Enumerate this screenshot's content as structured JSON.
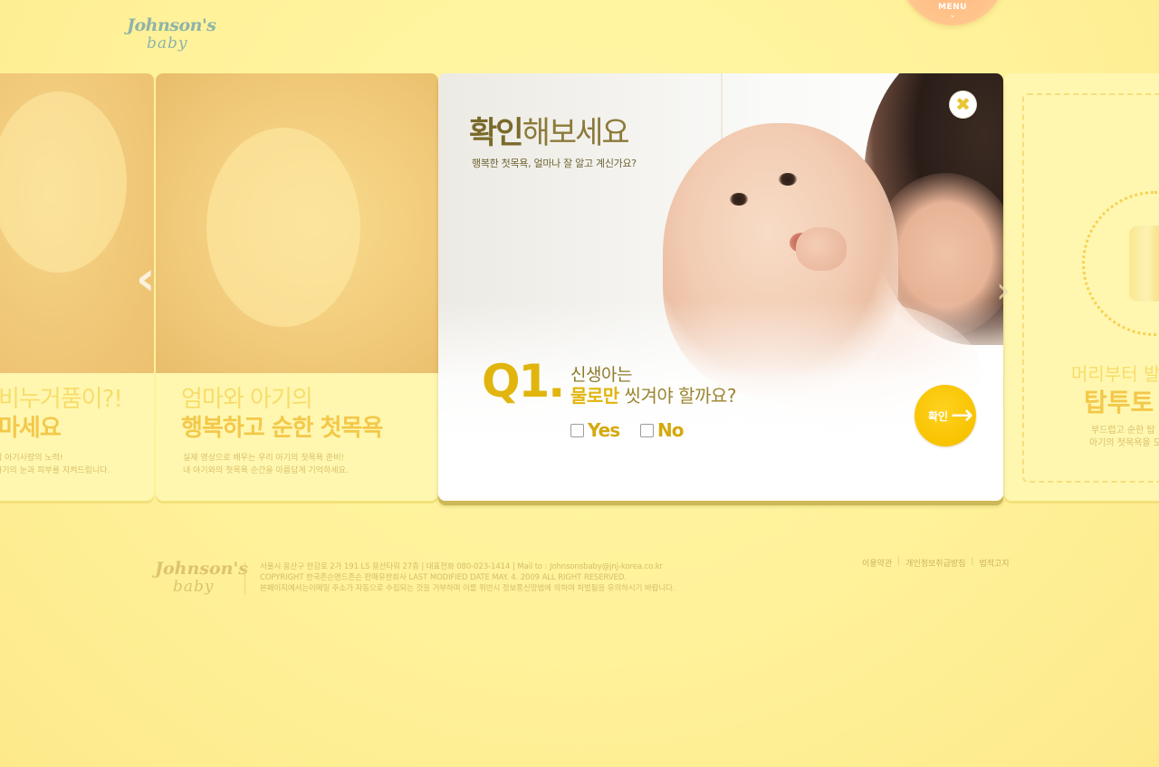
{
  "header": {
    "logo_line1": "Johnson's",
    "logo_line2": "baby",
    "menu_label": "MENU",
    "menu_chevron": "⌄"
  },
  "carousel": {
    "left_card_1": {
      "title_line1": "비누거품이?!",
      "title_line2": "마세요",
      "text_line1": "이 아기사랑의 노력!",
      "text_line2": "아기의 눈과 피부를 지켜드립니다."
    },
    "left_card_2": {
      "title_line1": "엄마와 아기의",
      "title_line2": "행복하고 순한 첫목욕",
      "text_line1": "실제 영상으로 배우는 우리 아기의 첫목욕 준비!",
      "text_line2": "내 아기와의 첫목욕 순간을 아름답게 기억하세요."
    },
    "right_card": {
      "title_line1": "머리부터 발",
      "title_line2": "탑투토",
      "text_line1": "부드럽고 순한 탑",
      "text_line2": "아기의 첫목욕을 도"
    },
    "prev_arrow": "‹",
    "next_arrow": "›"
  },
  "quiz": {
    "title_bold": "확인",
    "title_rest": "해보세요",
    "subtitle": "행복한 첫목욕, 얼마나 잘 알고 계신가요?",
    "close_icon": "✖",
    "question_number": "Q1.",
    "question_line1": "신생아는",
    "question_line2_highlight": "물로만",
    "question_line2_rest": " 씻겨야 할까요?",
    "options": [
      "Yes",
      "No"
    ],
    "confirm_label": "확인",
    "confirm_arrow": "→"
  },
  "footer": {
    "logo_line1": "Johnson's",
    "logo_line2": "baby",
    "address": "서울시 용산구 한강로 2가 191 LS 용산타워 27층  |  대표전화 080-023-1414  |  Mail to : Johnsonsbaby@jnj-korea.co.kr",
    "copyright": "COPYRIGHT 한국존슨앤드존슨 판매유한회사  LAST MODIFIED DATE MAY. 4. 2009 ALL RIGHT RESERVED.",
    "notice": "본페이지에서는이메일 주소가 자동으로 수집되는 것을 거부하며 이를 위반시 정보통신망법에 의하여 처벌됨을 유의하시기 바랍니다.",
    "links": [
      "이용약관",
      "개인정보취급방침",
      "법적고지"
    ]
  },
  "colors": {
    "background": "#fff29a",
    "accent": "#e1b50e",
    "menu_tab": "#ffc58c",
    "confirm_button": "#f8c300"
  }
}
